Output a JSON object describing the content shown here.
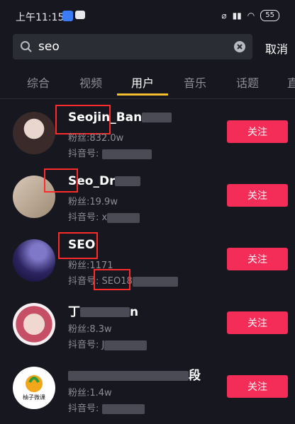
{
  "status": {
    "time": "上午11:15",
    "battery": "55"
  },
  "search": {
    "query": "seo",
    "cancel_label": "取消"
  },
  "tabs": [
    {
      "label": "综合"
    },
    {
      "label": "视频"
    },
    {
      "label": "用户"
    },
    {
      "label": "音乐"
    },
    {
      "label": "话题"
    },
    {
      "label": "直"
    }
  ],
  "follow_label": "关注",
  "users": [
    {
      "name": "Seojin_Ban",
      "fans": "粉丝:832.0w",
      "douyin": "抖音号:"
    },
    {
      "name": "Seo_Dr",
      "fans": "粉丝:19.9w",
      "douyin": "抖音号: x"
    },
    {
      "name": "SEO",
      "fans": "粉丝:1171",
      "douyin": "抖音号: SEO18"
    },
    {
      "name": "丁",
      "name_tail": "n",
      "fans": "粉丝:8.3w",
      "douyin": "抖音号: J"
    },
    {
      "name": "",
      "name_tail": "段",
      "fans": "粉丝:1.4w",
      "douyin": "抖音号:",
      "avatar_text": "柚子微课"
    }
  ]
}
